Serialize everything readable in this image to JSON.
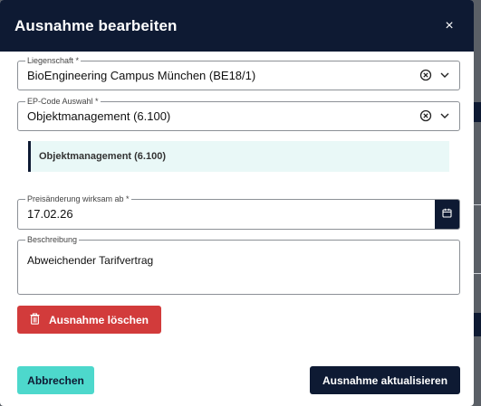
{
  "modal": {
    "title": "Ausnahme bearbeiten",
    "close_label": "×"
  },
  "liegenschaft": {
    "label": "Liegenschaft *",
    "value": "BioEngineering Campus München (BE18/1)"
  },
  "ep_code": {
    "label": "EP-Code Auswahl *",
    "value": "Objektmanagement (6.100)"
  },
  "selected_info": "Objektmanagement (6.100)",
  "preisaenderung": {
    "label": "Preisänderung wirksam ab *",
    "value": "17.02.26"
  },
  "beschreibung": {
    "label": "Beschreibung",
    "value": "Abweichender Tarifvertrag"
  },
  "buttons": {
    "delete": "Ausnahme löschen",
    "cancel": "Abbrechen",
    "update": "Ausnahme aktualisieren"
  },
  "colors": {
    "header_bg": "#0e1a33",
    "delete_bg": "#d23b3b",
    "cancel_bg": "#4dd8cc",
    "info_bg": "#e9f8f7"
  },
  "icons": [
    "close-icon",
    "clear-icon",
    "chevron-down-icon",
    "calendar-icon",
    "trash-icon"
  ]
}
